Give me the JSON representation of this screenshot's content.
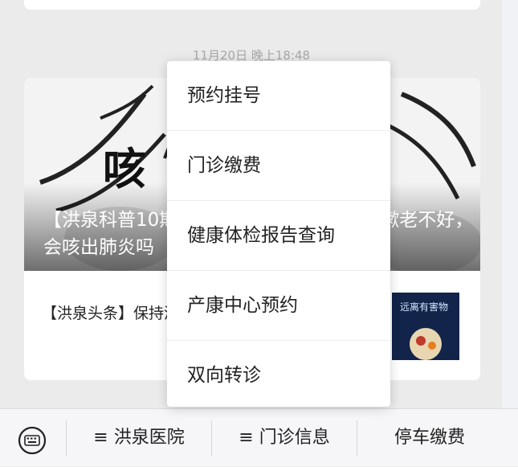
{
  "timestamp": "11月20日 晚上18:48",
  "article": {
    "cover_title": "【洪泉科普10期】入冬以后咳嗽不停？咳嗽老不好，会咳出肺炎吗",
    "cover_glyph": "咳",
    "sub_title": "【洪泉头条】保持清洁，远离有害物药物",
    "thumb_text": "远离有害物"
  },
  "popup_menu": {
    "items": [
      {
        "label": "预约挂号"
      },
      {
        "label": "门诊缴费"
      },
      {
        "label": "健康体检报告查询"
      },
      {
        "label": "产康中心预约"
      },
      {
        "label": "双向转诊"
      }
    ]
  },
  "bottom_bar": {
    "keyboard_icon": "keyboard-icon",
    "tabs": [
      {
        "label": "≡ 洪泉医院"
      },
      {
        "label": "≡ 门诊信息"
      },
      {
        "label": "停车缴费"
      }
    ]
  }
}
